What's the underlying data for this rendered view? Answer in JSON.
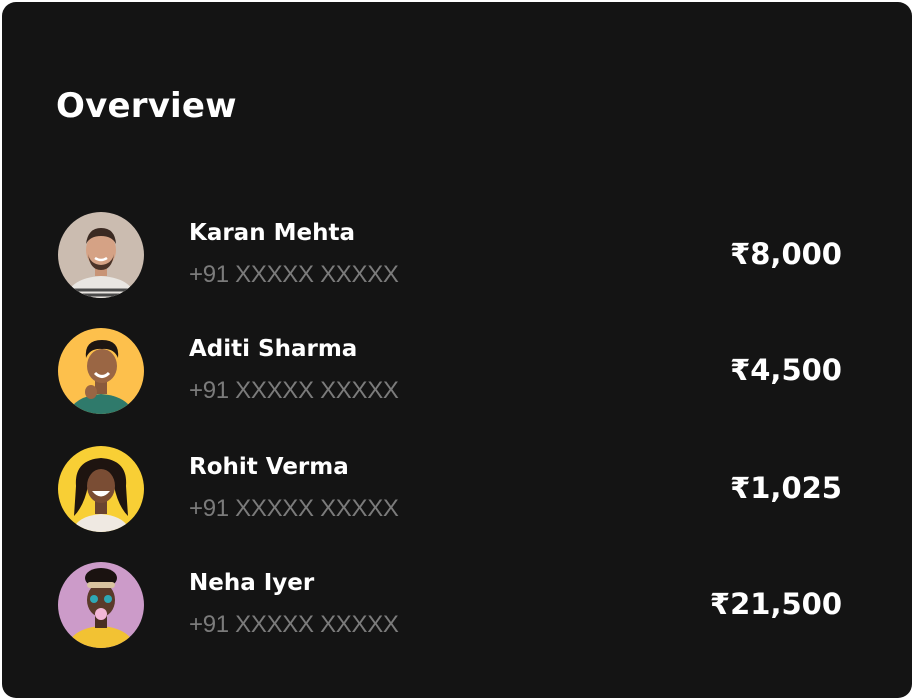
{
  "overview": {
    "title": "Overview",
    "contacts": [
      {
        "name": "Karan Mehta",
        "phone": "+91 XXXXX XXXXX",
        "amount": "₹8,000",
        "avatar_bg": "#cbbcb0"
      },
      {
        "name": "Aditi Sharma",
        "phone": "+91 XXXXX XXXXX",
        "amount": "₹4,500",
        "avatar_bg": "#fdc04c"
      },
      {
        "name": "Rohit Verma",
        "phone": "+91 XXXXX XXXXX",
        "amount": "₹1,025",
        "avatar_bg": "#f8cf35"
      },
      {
        "name": "Neha Iyer",
        "phone": "+91 XXXXX XXXXX",
        "amount": "₹21,500",
        "avatar_bg": "#cc9bc9"
      }
    ]
  }
}
